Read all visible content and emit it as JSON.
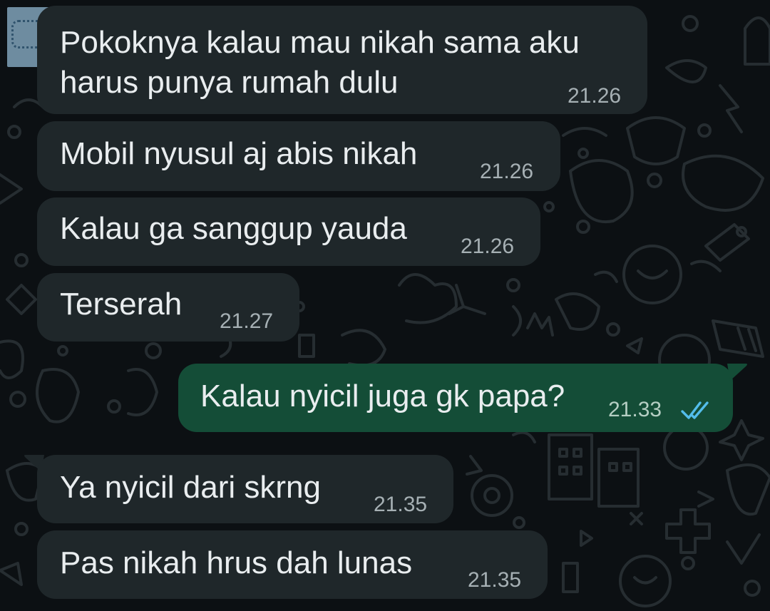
{
  "colors": {
    "background": "#0c1013",
    "incoming_bubble": "#1f272a",
    "outgoing_bubble": "#144d37",
    "text": "#e9edef",
    "timestamp": "#a6b0b4",
    "read_ticks": "#53bdeb"
  },
  "wallpaper": {
    "icon": "doodle-pattern-icon"
  },
  "messages": [
    {
      "direction": "incoming",
      "lines": [
        "Pokoknya kalau mau nikah sama aku",
        "harus punya rumah dulu"
      ],
      "time": "21.26"
    },
    {
      "direction": "incoming",
      "lines": [
        "Mobil nyusul aj abis nikah"
      ],
      "time": "21.26"
    },
    {
      "direction": "incoming",
      "lines": [
        "Kalau ga sanggup yauda"
      ],
      "time": "21.26"
    },
    {
      "direction": "incoming",
      "lines": [
        "Terserah"
      ],
      "time": "21.27"
    },
    {
      "direction": "outgoing",
      "lines": [
        "Kalau nyicil juga gk papa?"
      ],
      "time": "21.33",
      "status": "read",
      "status_icon": "double-check-icon"
    },
    {
      "direction": "incoming",
      "lines": [
        "Ya nyicil dari skrng"
      ],
      "time": "21.35"
    },
    {
      "direction": "incoming",
      "lines": [
        "Pas nikah hrus dah lunas"
      ],
      "time": "21.35"
    }
  ]
}
